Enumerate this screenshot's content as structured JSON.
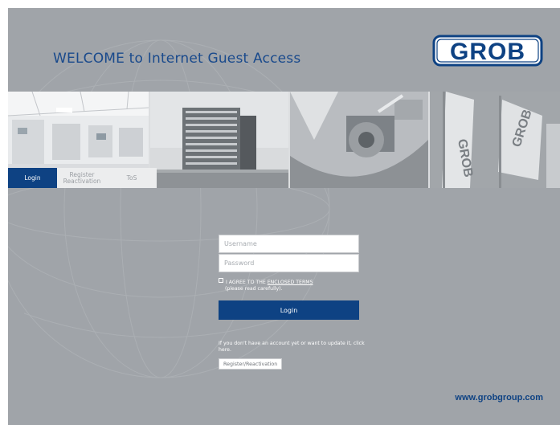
{
  "header": {
    "welcome": "WELCOME to Internet Guest Access",
    "logo_text": "GROB"
  },
  "tabs": [
    {
      "label": "Login",
      "active": true
    },
    {
      "label": "Register Reactivation",
      "active": false
    },
    {
      "label": "ToS",
      "active": false
    }
  ],
  "login_form": {
    "username_placeholder": "Username",
    "password_placeholder": "Password",
    "agree_prefix": "I AGREE TO THE",
    "agree_link": "ENCLOSED TERMS",
    "agree_note": "(please read carefully).",
    "login_label": "Login"
  },
  "info": {
    "text": "If you don't have an account yet or want to update it, click here.",
    "register_label": "Register/Reactivation"
  },
  "footer": {
    "website": "www.grobgroup.com"
  },
  "colors": {
    "brand_blue": "#0e4283",
    "background_grey": "#a0a4a9"
  },
  "icons": [
    "checkbox-icon"
  ]
}
